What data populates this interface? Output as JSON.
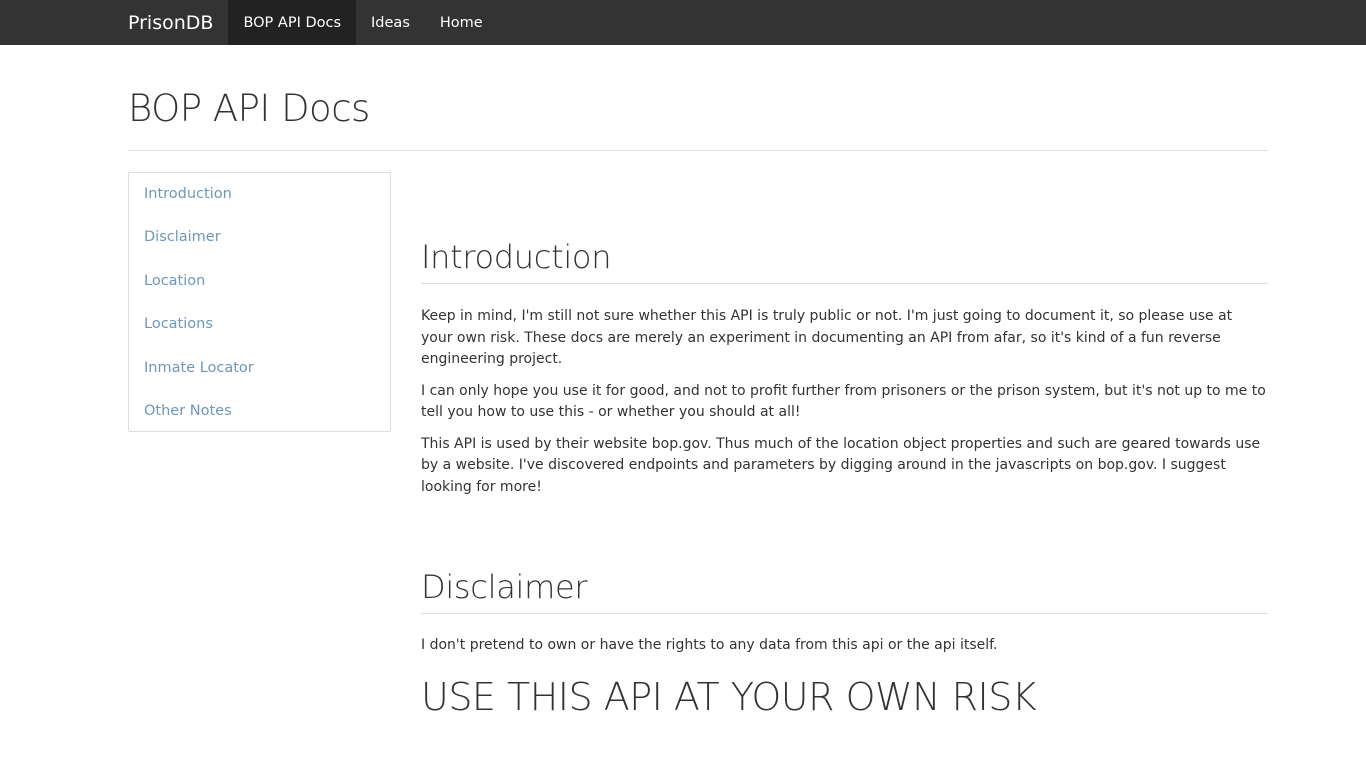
{
  "navbar": {
    "brand": "PrisonDB",
    "links": [
      {
        "label": "BOP API Docs",
        "active": true
      },
      {
        "label": "Ideas",
        "active": false
      },
      {
        "label": "Home",
        "active": false
      }
    ]
  },
  "page": {
    "title": "BOP API Docs"
  },
  "sidebar": {
    "items": [
      {
        "label": "Introduction"
      },
      {
        "label": "Disclaimer"
      },
      {
        "label": "Location"
      },
      {
        "label": "Locations"
      },
      {
        "label": "Inmate Locator"
      },
      {
        "label": "Other Notes"
      }
    ]
  },
  "introduction": {
    "heading": "Introduction",
    "paragraphs": [
      "Keep in mind, I'm still not sure whether this API is truly public or not. I'm just going to document it, so please use at your own risk. These docs are merely an experiment in documenting an API from afar, so it's kind of a fun reverse engineering project.",
      "I can only hope you use it for good, and not to profit further from prisoners or the prison system, but it's not up to me to tell you how to use this - or whether you should at all!",
      "This API is used by their website bop.gov. Thus much of the location object properties and such are geared towards use by a website. I've discovered endpoints and parameters by digging around in the javascripts on bop.gov. I suggest looking for more!"
    ]
  },
  "disclaimer": {
    "heading": "Disclaimer",
    "paragraph": "I don't pretend to own or have the rights to any data from this api or the api itself.",
    "warning": "USE THIS API AT YOUR OWN RISK"
  },
  "colors": {
    "navbar_bg": "#333333",
    "navbar_active_bg": "#222222",
    "link": "#6f97b8",
    "text": "#333333",
    "divider": "#dddddd"
  }
}
